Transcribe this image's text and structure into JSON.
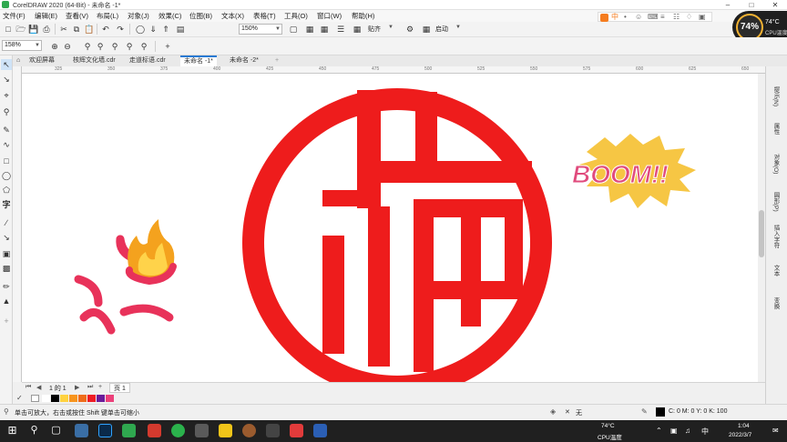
{
  "window": {
    "title": "CorelDRAW 2020 (64-Bit) - 未命名 -1*"
  },
  "menubar": {
    "items": [
      "文件(F)",
      "编辑(E)",
      "查看(V)",
      "布局(L)",
      "对象(J)",
      "效果(C)",
      "位图(B)",
      "文本(X)",
      "表格(T)",
      "工具(O)",
      "窗口(W)",
      "帮助(H)"
    ]
  },
  "toolbar": {
    "zoom_value": "158%",
    "zoom_value_2": "150%",
    "snap_label": "贴齐",
    "launch_label": "启动"
  },
  "doc_tabs": [
    "欢迎屏幕",
    "核辉文化墙.cdr",
    "走道标语.cdr",
    "未命名 -1*",
    "未命名 -2*"
  ],
  "ruler_ticks": [
    "325",
    "350",
    "375",
    "400",
    "425",
    "450",
    "475",
    "500",
    "525",
    "550",
    "575",
    "600",
    "625",
    "650"
  ],
  "canvas": {
    "boom_text": "BOOM!!",
    "fu_color": "#ee1c1c"
  },
  "pagebar": {
    "page_label": "页 1",
    "page_counter": "1 的 1"
  },
  "dockers": [
    "提示(N)",
    "属性",
    "对象(O)",
    "圆形(P)",
    "插入字符",
    "文本",
    "变换"
  ],
  "statusbar": {
    "hint": "单击可放大，右击或按住 Shift 键单击可缩小",
    "fill_label": "无",
    "color_model": "C: 0 M: 0 Y: 0 K: 100"
  },
  "cpu_widget": {
    "percent": "74%",
    "temp": "74°C",
    "label": "CPU温度"
  },
  "ime": {
    "items": [
      "中",
      "•",
      "☺",
      "⌨",
      "≡",
      "☷",
      "♢",
      "▣"
    ]
  },
  "taskbar": {
    "temp": "74°C",
    "temp_label": "CPU温度",
    "time": "1:04",
    "date": "2022/3/7",
    "ime": "中"
  },
  "palette_colors": [
    "#ffffff",
    "#000000",
    "#ffd23f",
    "#f7941d",
    "#ef6c1a",
    "#ee1c25",
    "#6a1b9a",
    "#ec407a"
  ]
}
